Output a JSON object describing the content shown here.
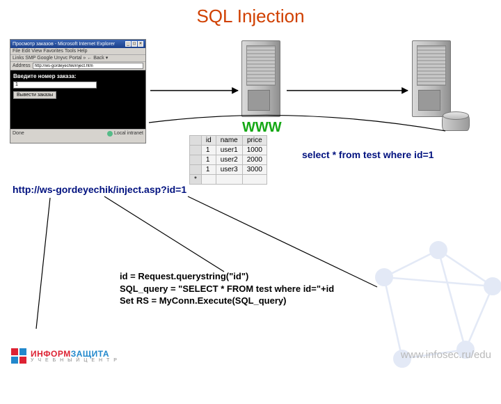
{
  "title": "SQL Injection",
  "browser": {
    "window_title": "Просмотр заказов - Microsoft Internet Explorer",
    "menu": "File  Edit  View  Favorites  Tools  Help",
    "linksbar": "Links  SMP  Google  Unyvc  Portal   »   ← Back ▾",
    "addr_label": "Address",
    "addr_value": "http://ws-gordeyechik/inject.htm",
    "prompt": "Введите номер заказа:",
    "input_value": "1",
    "button_label": "Вывести заказы",
    "status_done": "Done",
    "status_zone": "Local intranet"
  },
  "www_label": "WWW",
  "table": {
    "headers": [
      "",
      "id",
      "name",
      "price"
    ],
    "rows": [
      [
        "",
        "1",
        "user1",
        "1000"
      ],
      [
        "",
        "1",
        "user2",
        "2000"
      ],
      [
        "",
        "1",
        "user3",
        "3000"
      ],
      [
        "*",
        "",
        "",
        ""
      ]
    ]
  },
  "sql_result": "select * from test where id=1",
  "url_text": "http://ws-gordeyechik/inject.asp?id=1",
  "code": "id = Request.querystring(\"id\")\nSQL_query = \"SELECT * FROM test where id=\"+id\nSet RS = MyConn.Execute(SQL_query)",
  "footer": {
    "brand_a": "ИНФОРМ",
    "brand_b": "ЗАЩИТА",
    "sub": "У Ч Е Б Н Ы Й   Ц Е Н Т Р",
    "url": "www.infosec.ru/edu"
  }
}
